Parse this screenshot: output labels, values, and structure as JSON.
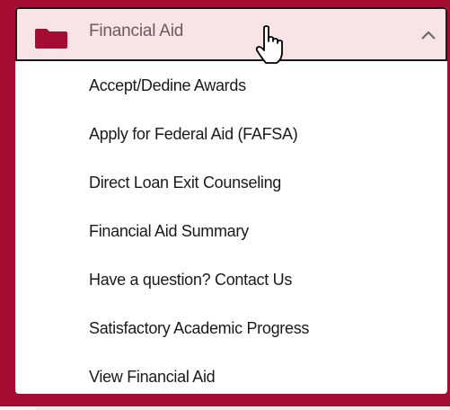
{
  "menu": {
    "title": "Financial Aid",
    "expanded": true,
    "accent_color": "#a40c32",
    "header_bg_color": "#f8e3e7",
    "icons": {
      "folder": "folder-icon",
      "toggle": "chevron-up-icon",
      "cursor": "hand-pointer-icon"
    },
    "items": [
      {
        "label": "Accept/Dedine Awards"
      },
      {
        "label": "Apply for Federal Aid (FAFSA)"
      },
      {
        "label": "Direct Loan Exit Counseling"
      },
      {
        "label": "Financial Aid Summary"
      },
      {
        "label": "Have a question? Contact Us"
      },
      {
        "label": "Satisfactory Academic Progress"
      },
      {
        "label": "View Financial Aid"
      }
    ]
  }
}
